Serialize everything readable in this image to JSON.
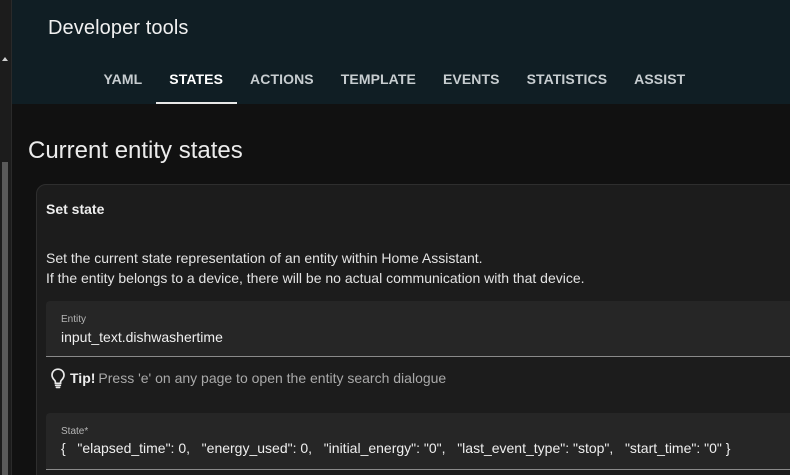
{
  "header": {
    "title": "Developer tools",
    "tabs": [
      {
        "label": "YAML"
      },
      {
        "label": "STATES"
      },
      {
        "label": "ACTIONS"
      },
      {
        "label": "TEMPLATE"
      },
      {
        "label": "EVENTS"
      },
      {
        "label": "STATISTICS"
      },
      {
        "label": "ASSIST"
      }
    ],
    "active_tab": "STATES"
  },
  "main": {
    "page_title": "Current entity states",
    "set_state": {
      "title": "Set state",
      "description_line1": "Set the current state representation of an entity within Home Assistant.",
      "description_line2": "If the entity belongs to a device, there will be no actual communication with that device.",
      "entity": {
        "label": "Entity",
        "value": "input_text.dishwashertime"
      },
      "tip": {
        "label": "Tip!",
        "text": "Press 'e' on any page to open the entity search dialogue",
        "icon": "lightbulb-icon"
      },
      "state": {
        "label": "State*",
        "value": "{   \"elapsed_time\": 0,   \"energy_used\": 0,   \"initial_energy\": \"0\",   \"last_event_type\": \"stop\",   \"start_time\": \"0\" }"
      }
    }
  },
  "colors": {
    "header_bg": "#101e24",
    "page_bg": "#111111",
    "card_bg": "#1c1c1c",
    "field_bg": "#262626"
  }
}
